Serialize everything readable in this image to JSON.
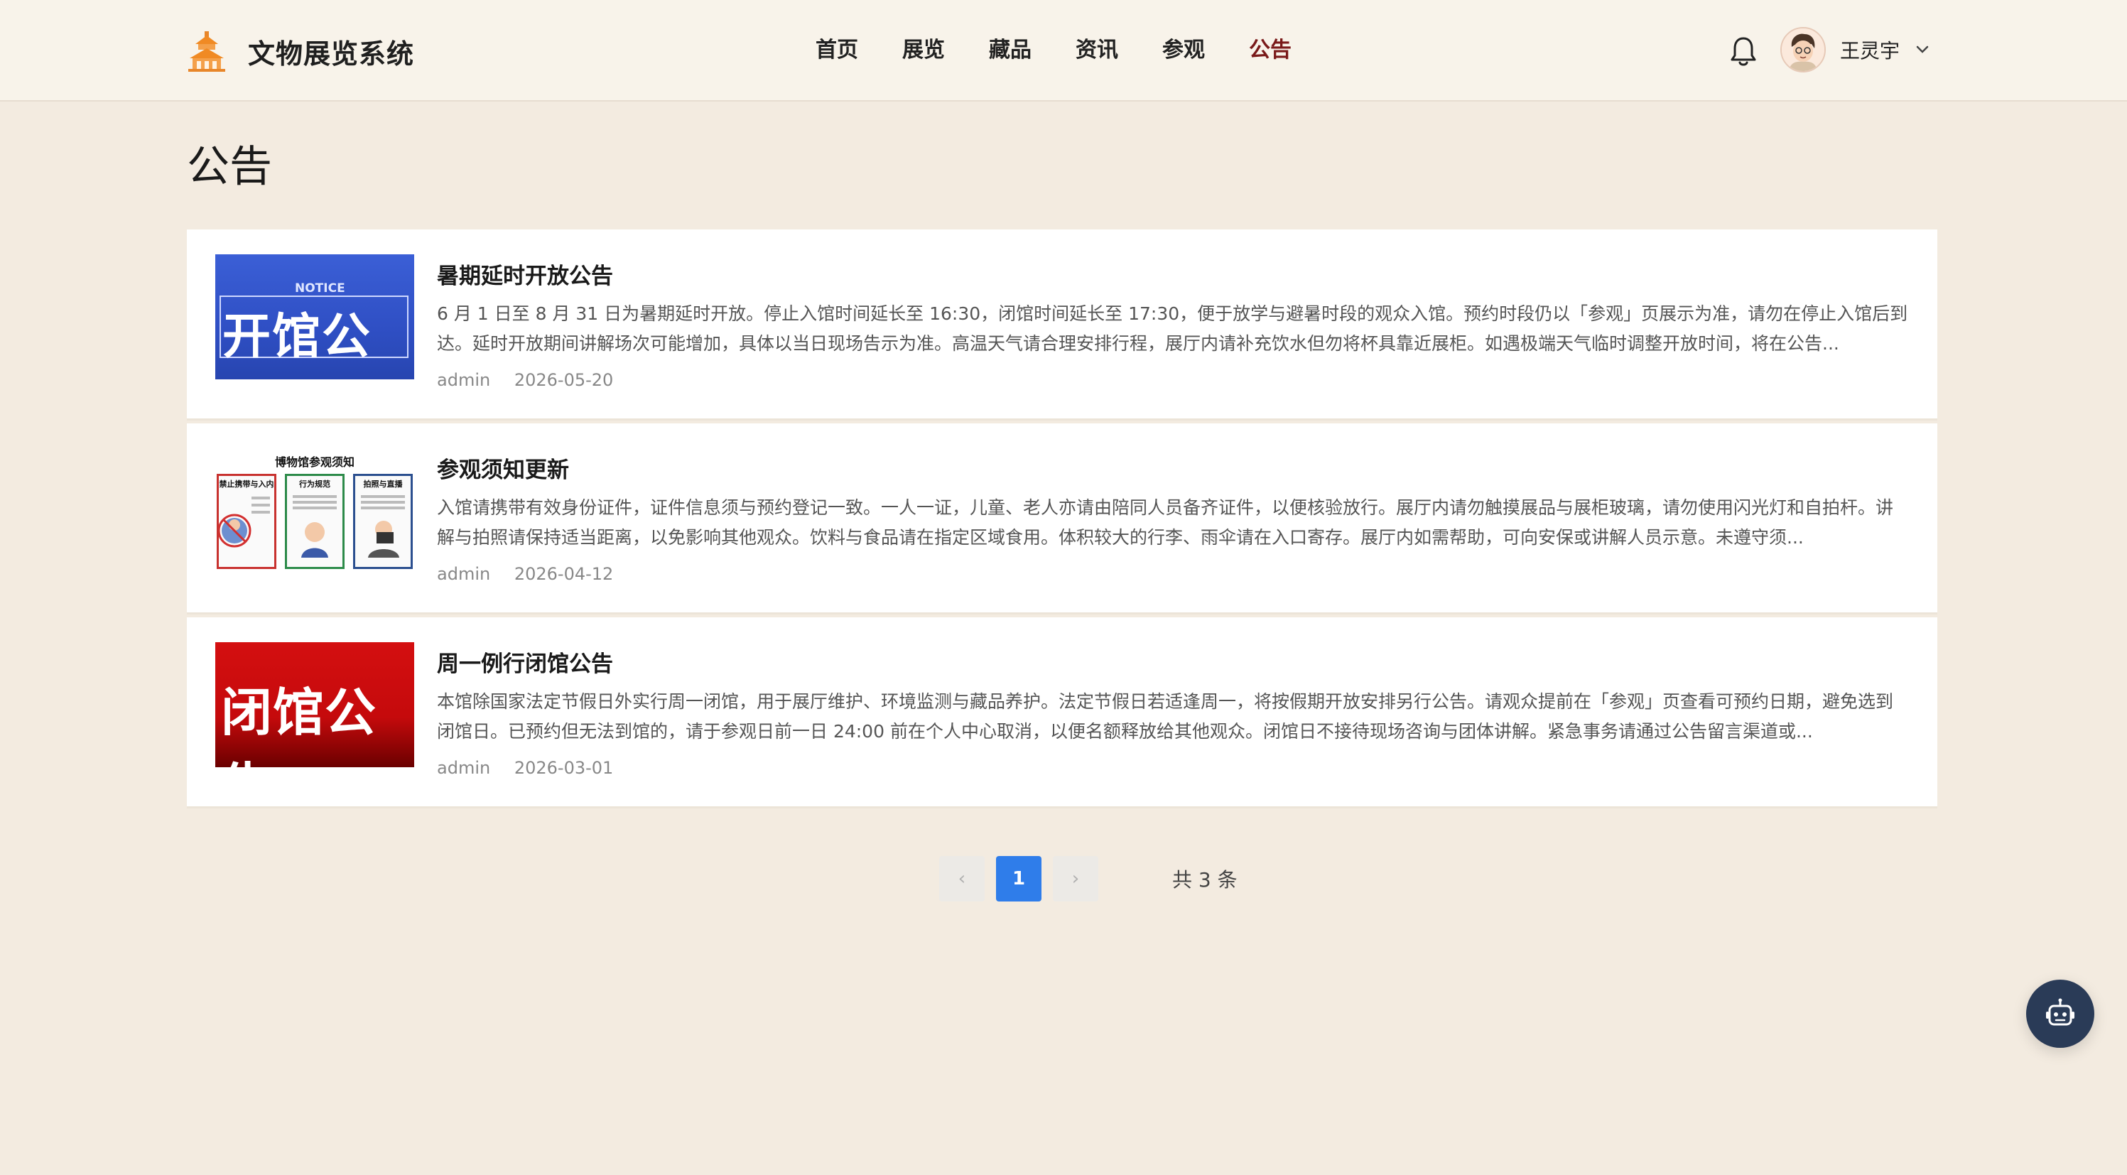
{
  "header": {
    "app_title": "文物展览系统",
    "nav": [
      {
        "label": "首页",
        "active": false
      },
      {
        "label": "展览",
        "active": false
      },
      {
        "label": "藏品",
        "active": false
      },
      {
        "label": "资讯",
        "active": false
      },
      {
        "label": "参观",
        "active": false
      },
      {
        "label": "公告",
        "active": true
      }
    ],
    "user_name": "王灵宇",
    "icons": [
      "palace-logo-icon",
      "bell-icon",
      "avatar",
      "chevron-down-icon"
    ]
  },
  "page_title": "公告",
  "notices": [
    {
      "title": "暑期延时开放公告",
      "desc": "6 月 1 日至 8 月 31 日为暑期延时开放。停止入馆时间延长至 16:30，闭馆时间延长至 17:30，便于放学与避暑时段的观众入馆。预约时段仍以「参观」页展示为准，请勿在停止入馆后到达。延时开放期间讲解场次可能增加，具体以当日现场告示为准。高温天气请合理安排行程，展厅内请补充饮水但勿将杯具靠近展柜。如遇极端天气临时调整开放时间，将在公告...",
      "author": "admin",
      "date": "2026-05-20",
      "thumb": {
        "kind": "blue",
        "small": "NOTICE",
        "big": "开馆公告"
      }
    },
    {
      "title": "参观须知更新",
      "desc": "入馆请携带有效身份证件，证件信息须与预约登记一致。一人一证，儿童、老人亦请由陪同人员备齐证件，以便核验放行。展厅内请勿触摸展品与展柜玻璃，请勿使用闪光灯和自拍杆。讲解与拍照请保持适当距离，以免影响其他观众。饮料与食品请在指定区域食用。体积较大的行李、雨伞请在入口寄存。展厅内如需帮助，可向安保或讲解人员示意。未遵守须...",
      "author": "admin",
      "date": "2026-04-12",
      "thumb": {
        "kind": "poster",
        "title": "博物馆参观须知",
        "cols": [
          "禁止携带与入内",
          "行为规范",
          "拍照与直播"
        ]
      }
    },
    {
      "title": "周一例行闭馆公告",
      "desc": "本馆除国家法定节假日外实行周一闭馆，用于展厅维护、环境监测与藏品养护。法定节假日若适逢周一，将按假期开放安排另行公告。请观众提前在「参观」页查看可预约日期，避免选到闭馆日。已预约但无法到馆的，请于参观日前一日 24:00 前在个人中心取消，以便名额释放给其他观众。闭馆日不接待现场咨询与团体讲解。紧急事务请通过公告留言渠道或...",
      "author": "admin",
      "date": "2026-03-01",
      "thumb": {
        "kind": "red",
        "big": "闭馆公告"
      }
    }
  ],
  "pagination": {
    "prev": "‹",
    "current": "1",
    "next": "›",
    "total_text": "共 3 条"
  },
  "colors": {
    "background": "#f3ebe0",
    "header": "#f8f3ea",
    "active_nav": "#7a1a1a",
    "page_current": "#2f7dea",
    "robot_button": "#2a3b57",
    "logo": "#e8862a"
  }
}
